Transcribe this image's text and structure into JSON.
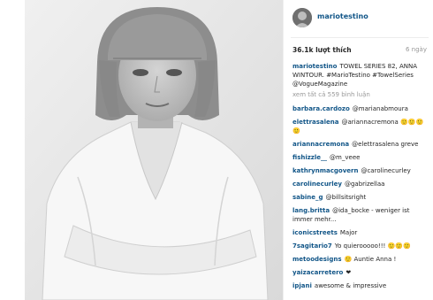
{
  "post": {
    "username": "mariotestino",
    "likes": "36.1k lượt thích",
    "time": "6 ngày",
    "caption_user": "mariotestino",
    "caption_text": "TOWEL SERIES 82, ANNA WINTOUR. #MarioTestino #TowelSeries @VogueMagazine",
    "view_all": "xem tất cả 559 bình luận"
  },
  "comments": [
    {
      "user": "barbara.cardozo",
      "text": "@marianabmoura"
    },
    {
      "user": "elettrasalena",
      "text": "@ariannacremona 🙂🙂🙂🙂"
    },
    {
      "user": "ariannacremona",
      "text": "@elettrasalena greve"
    },
    {
      "user": "fishizzle__",
      "text": "@m_veee"
    },
    {
      "user": "kathrynmacgovern",
      "text": "@carolinecurley"
    },
    {
      "user": "carolinecurley",
      "text": "@gabrizellaa"
    },
    {
      "user": "sabine_g",
      "text": "@billsitsright"
    },
    {
      "user": "lang.britta",
      "text": "@ida_bocke - weniger ist immer mehr..."
    },
    {
      "user": "iconicstreets",
      "text": "Major"
    },
    {
      "user": "7sagitario7",
      "text": "Yo quierooooo!!! 🙂🙂🙂"
    },
    {
      "user": "metoodesigns",
      "text": "🙂 Auntie Anna !"
    },
    {
      "user": "yaizacarretero",
      "text": "❤"
    },
    {
      "user": "ipjani",
      "text": "awesome & impressive"
    }
  ]
}
